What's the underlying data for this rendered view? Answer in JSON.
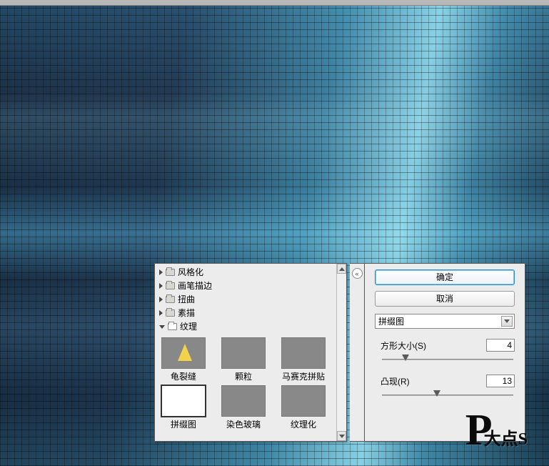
{
  "buttons": {
    "ok": "确定",
    "cancel": "取消"
  },
  "collapse_glyph": "«",
  "filter_select": {
    "selected": "拼缀图"
  },
  "categories": [
    {
      "label": "风格化",
      "expanded": false
    },
    {
      "label": "画笔描边",
      "expanded": false
    },
    {
      "label": "扭曲",
      "expanded": false
    },
    {
      "label": "素描",
      "expanded": false
    },
    {
      "label": "纹理",
      "expanded": true
    }
  ],
  "thumbnails": [
    {
      "label": "龟裂缝",
      "selected": false
    },
    {
      "label": "颗粒",
      "selected": false
    },
    {
      "label": "马赛克拼贴",
      "selected": false
    },
    {
      "label": "拼缀图",
      "selected": true
    },
    {
      "label": "染色玻璃",
      "selected": false
    },
    {
      "label": "纹理化",
      "selected": false
    }
  ],
  "params": {
    "square_size": {
      "label": "方形大小(S)",
      "value": "4",
      "pos_pct": 18
    },
    "relief": {
      "label": "凸现(R)",
      "value": "13",
      "pos_pct": 42
    }
  },
  "watermark": {
    "big": "P",
    "small": "大点S"
  }
}
